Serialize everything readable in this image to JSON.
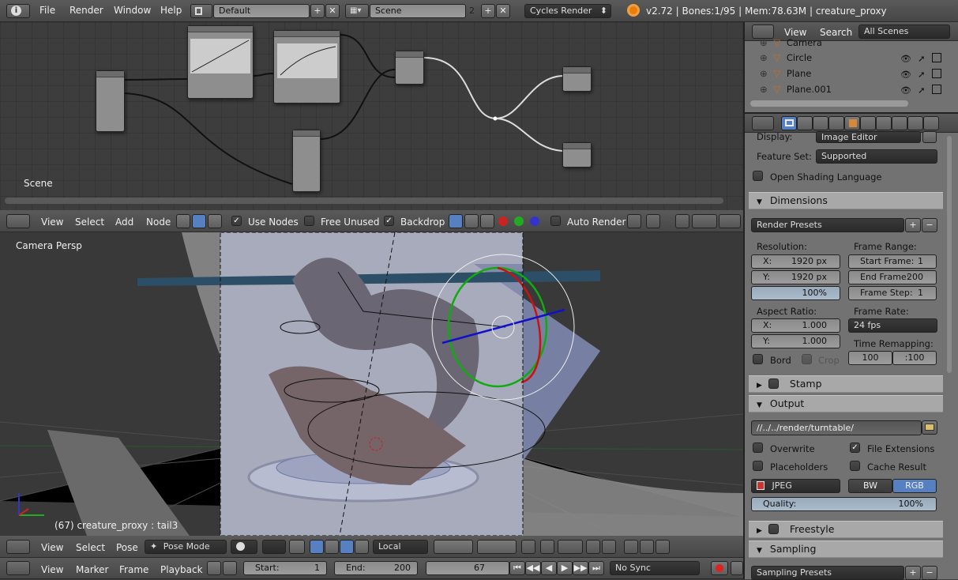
{
  "topbar": {
    "menus": [
      "File",
      "Render",
      "Window",
      "Help"
    ],
    "layout_name": "Default",
    "scene_name": "Scene",
    "scene_users": "2",
    "engine": "Cycles Render",
    "status": "v2.72 | Bones:1/95  | Mem:78.63M | creature_proxy"
  },
  "node_editor": {
    "label": "Scene",
    "menus": [
      "View",
      "Select",
      "Add",
      "Node"
    ],
    "use_nodes_label": "Use Nodes",
    "free_unused_label": "Free Unused",
    "backdrop_label": "Backdrop",
    "auto_render_label": "Auto Render",
    "use_nodes_checked": true,
    "free_unused_checked": false,
    "backdrop_checked": true,
    "auto_render_checked": false
  },
  "viewport": {
    "view_label": "Camera Persp",
    "object_info": "(67) creature_proxy : tail3",
    "menus": [
      "View",
      "Select",
      "Pose"
    ],
    "mode": "Pose Mode",
    "orientation": "Local"
  },
  "timeline": {
    "menus": [
      "View",
      "Marker",
      "Frame",
      "Playback"
    ],
    "start_label": "Start:",
    "start": "1",
    "end_label": "End:",
    "end": "200",
    "current": "67",
    "sync": "No Sync"
  },
  "outliner": {
    "menus": [
      "View",
      "Search"
    ],
    "filter": "All Scenes",
    "items": [
      {
        "name": "Camera"
      },
      {
        "name": "Circle"
      },
      {
        "name": "Plane"
      },
      {
        "name": "Plane.001"
      }
    ]
  },
  "properties": {
    "display_label": "Display:",
    "display_value": "Image Editor",
    "feature_set_label": "Feature Set:",
    "feature_set_value": "Supported",
    "osl_label": "Open Shading Language",
    "dimensions": {
      "title": "Dimensions",
      "presets": "Render Presets",
      "resolution_label": "Resolution:",
      "res_x": "X:",
      "res_x_val": "1920 px",
      "res_y": "Y:",
      "res_y_val": "1920 px",
      "res_pct": "100%",
      "frame_range_label": "Frame Range:",
      "start_frame": "Start Frame:",
      "start_frame_val": "1",
      "end_frame": "End Frame:",
      "end_frame_val": "200",
      "frame_step": "Frame Step:",
      "frame_step_val": "1",
      "aspect_label": "Aspect Ratio:",
      "asp_x": "X:",
      "asp_x_val": "1.000",
      "asp_y": "Y:",
      "asp_y_val": "1.000",
      "frame_rate_label": "Frame Rate:",
      "frame_rate": "24 fps",
      "time_remap_label": "Time Remapping:",
      "remap_old": "100",
      "remap_new": ":100",
      "bord_label": "Bord",
      "crop_label": "Crop"
    },
    "stamp": "Stamp",
    "output": {
      "title": "Output",
      "path": "//../../render/turntable/",
      "overwrite": "Overwrite",
      "file_extensions": "File Extensions",
      "placeholders": "Placeholders",
      "cache_result": "Cache Result",
      "format": "JPEG",
      "bw": "BW",
      "rgb": "RGB",
      "quality_label": "Quality:",
      "quality": "100%"
    },
    "freestyle": "Freestyle",
    "sampling": {
      "title": "Sampling",
      "presets": "Sampling Presets"
    }
  },
  "colors": {
    "header_bg": "#4f4f4f",
    "node_bg": "#3d3d3d",
    "viewport_bg": "#393939",
    "properties_bg": "#727272",
    "selected_blue": "#5680c2"
  }
}
